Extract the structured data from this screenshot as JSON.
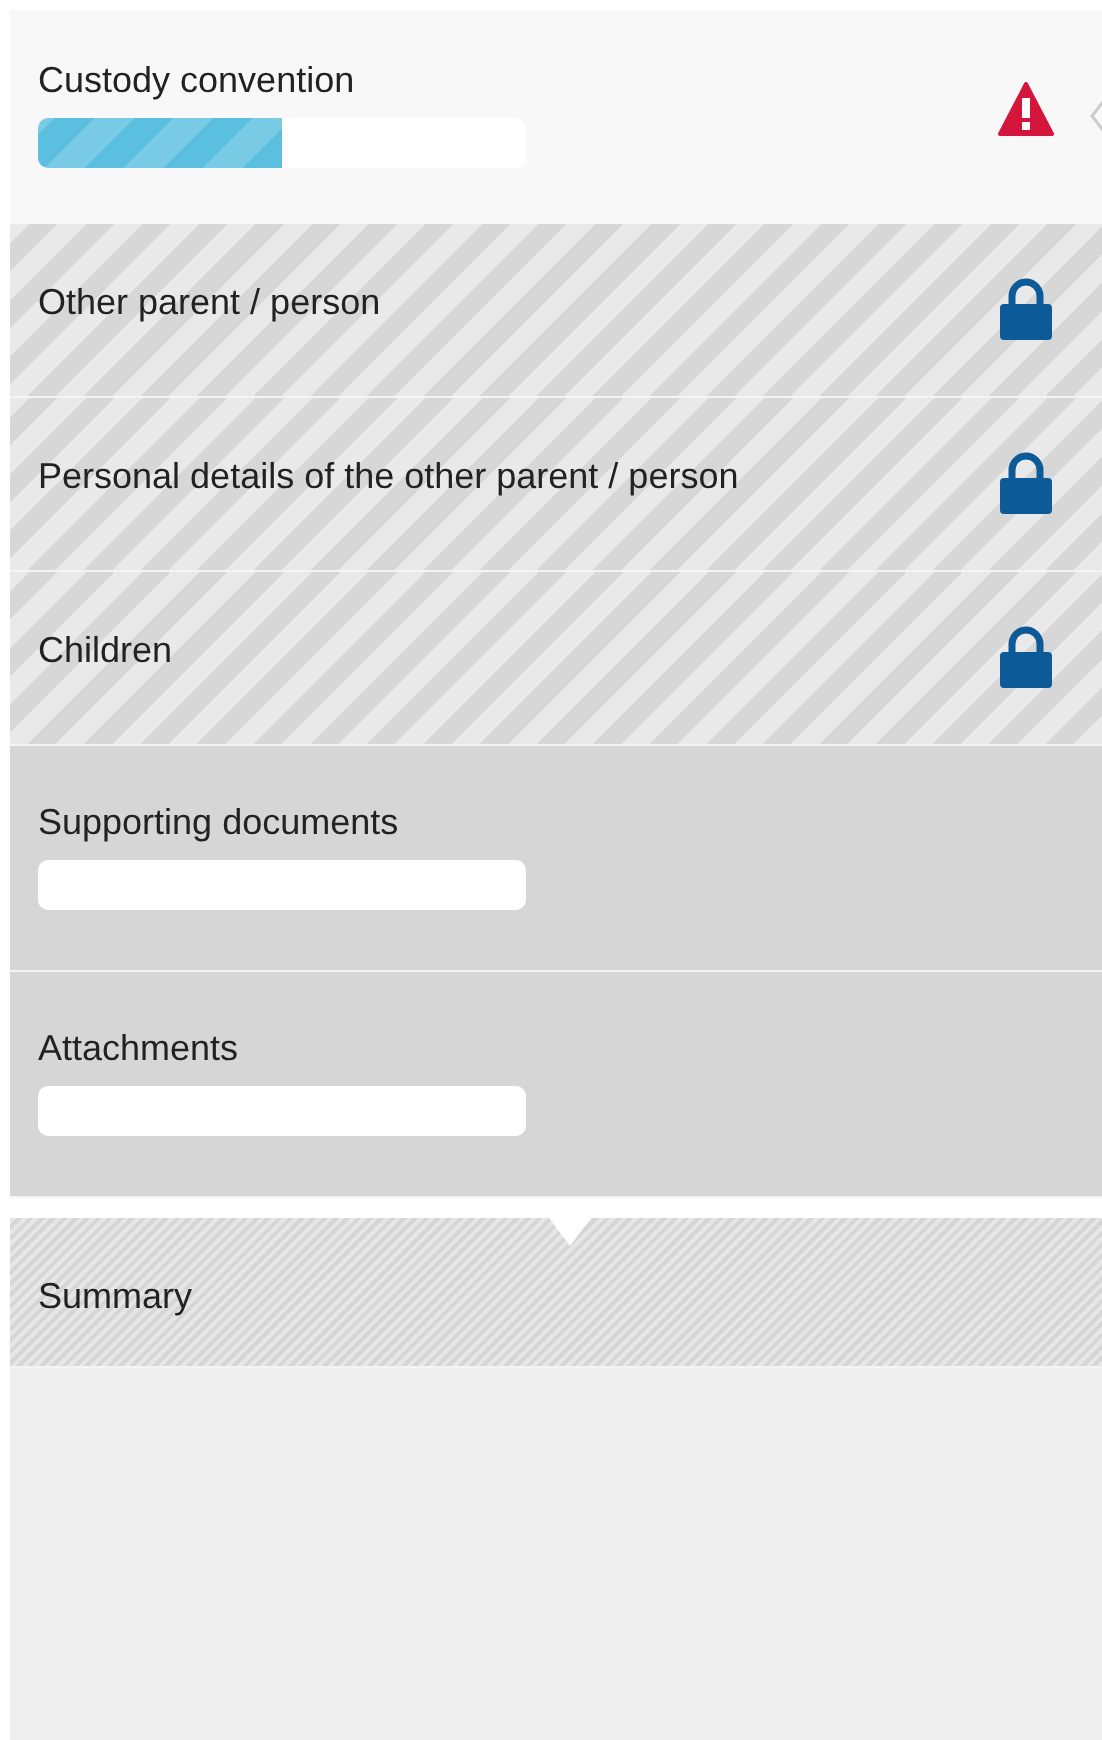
{
  "steps": [
    {
      "kind": "active",
      "label": "Custody convention",
      "level": 0.5,
      "warning": true
    },
    {
      "kind": "locked",
      "label": "Other parent / person"
    },
    {
      "kind": "locked",
      "label": "Personal details of the other parent / person"
    },
    {
      "kind": "locked",
      "label": "Children"
    },
    {
      "kind": "pending",
      "label": "Supporting documents",
      "level": 0
    },
    {
      "kind": "pending",
      "label": "Attachments",
      "level": 0
    },
    {
      "kind": "summary",
      "label": "Summary"
    }
  ]
}
